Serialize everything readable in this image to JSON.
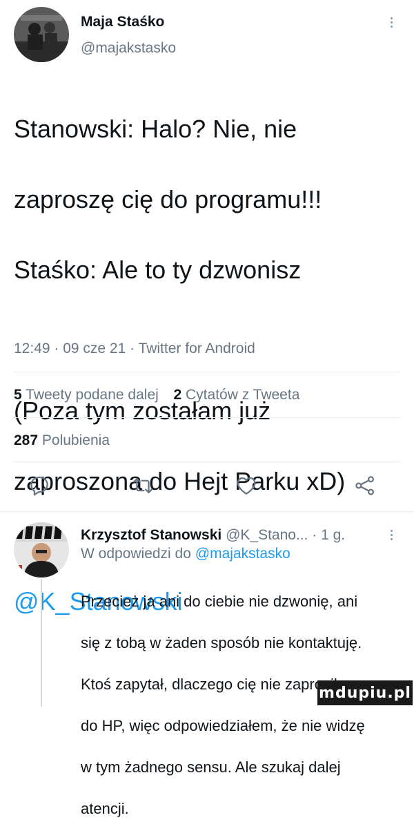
{
  "tweet": {
    "author_name": "Maja Staśko",
    "author_handle": "@majakstasko",
    "lines": [
      "Stanowski: Halo? Nie, nie",
      "zaproszę cię do programu!!!",
      "Staśko: Ale to ty dzwonisz",
      "",
      "(Poza tym zostałam już",
      "zaproszona do Hejt Parku xD)"
    ],
    "mention": "@K_Stanowski",
    "timestamp": "12:49 · 09 cze 21 · Twitter for Android"
  },
  "stats": {
    "retweets_count": "5",
    "retweets_label": "Tweety podane dalej",
    "quotes_count": "2",
    "quotes_label": "Cytatów z Tweeta",
    "likes_count": "287",
    "likes_label": "Polubienia"
  },
  "actions": {
    "icons": [
      "comment-icon",
      "retweet-icon",
      "like-icon",
      "share-icon"
    ]
  },
  "reply": {
    "author_name": "Krzysztof Stanowski",
    "author_handle_time": "@K_Stano... · 1 g.",
    "replying_to_prefix": "W odpowiedzi do ",
    "replying_to_handle": "@majakstasko",
    "lines": [
      "Przecież ja ani do ciebie nie dzwonię, ani",
      "się z tobą w żaden sposób nie kontaktuję.",
      "Ktoś zapytał, dlaczego cię nie zaprosiłem",
      "do HP, więc odpowiedziałem, że nie widzę",
      "w tym żadnego sensu. Ale szukaj dalej",
      "atencji."
    ]
  },
  "watermark": "mdupiu.pl",
  "colors": {
    "accent": "#1d9bf0",
    "secondary_text": "#687684",
    "divider": "#e6ecf0"
  }
}
